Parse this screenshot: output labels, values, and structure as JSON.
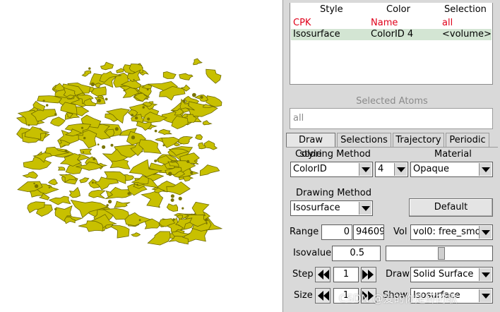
{
  "viewport": {
    "render": "yellow isosurface volume cube",
    "surface_color": "#c8c000"
  },
  "rep_table": {
    "headers": {
      "style": "Style",
      "color": "Color",
      "selection": "Selection"
    },
    "rows": [
      {
        "style": "CPK",
        "color": "Name",
        "selection": "all",
        "highlight": false,
        "text_color": "#e0001a"
      },
      {
        "style": "Isosurface",
        "color": "ColorID 4",
        "selection": "<volume>",
        "highlight": true,
        "text_color": "#000000"
      }
    ]
  },
  "selected_atoms": {
    "title": "Selected Atoms",
    "value": "all"
  },
  "tabs": [
    {
      "label": "Draw style",
      "active": true
    },
    {
      "label": "Selections",
      "active": false
    },
    {
      "label": "Trajectory",
      "active": false
    },
    {
      "label": "Periodic",
      "active": false
    }
  ],
  "coloring": {
    "label": "Coloring Method",
    "method": "ColorID",
    "id": "4"
  },
  "material": {
    "label": "Material",
    "value": "Opaque"
  },
  "drawing": {
    "label": "Drawing Method",
    "value": "Isosurface",
    "default_button": "Default"
  },
  "range": {
    "label": "Range",
    "min": "0",
    "max": "94609"
  },
  "vol": {
    "label": "Vol",
    "value": "vol0: free_smo"
  },
  "isovalue": {
    "label": "Isovalue",
    "value": "0.5",
    "slider_fraction": 0.52
  },
  "step": {
    "label": "Step",
    "value": "1"
  },
  "draw": {
    "label": "Draw",
    "value": "Solid Surface"
  },
  "size": {
    "label": "Size",
    "value": "1"
  },
  "show": {
    "label": "Show",
    "value": "Isosurface"
  },
  "watermark": "CSDN @爱的你是碎的歌"
}
